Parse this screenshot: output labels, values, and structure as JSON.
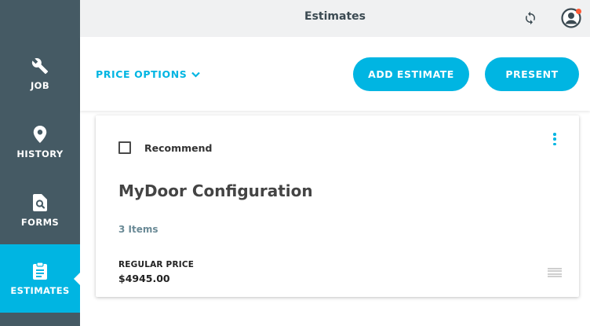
{
  "header": {
    "title": "Estimates"
  },
  "sidebar": {
    "items": [
      {
        "label": "JOB",
        "icon": "wrench-icon"
      },
      {
        "label": "HISTORY",
        "icon": "map-pin-icon"
      },
      {
        "label": "FORMS",
        "icon": "document-search-icon"
      },
      {
        "label": "ESTIMATES",
        "icon": "clipboard-icon",
        "active": true
      }
    ]
  },
  "toolbar": {
    "price_options_label": "PRICE OPTIONS",
    "add_estimate_label": "ADD ESTIMATE",
    "present_label": "PRESENT"
  },
  "estimate_card": {
    "recommend_label": "Recommend",
    "recommend_checked": false,
    "title": "MyDoor Configuration",
    "item_count": "3 Items",
    "regular_price_label": "REGULAR PRICE",
    "regular_price_value": "$4945.00"
  },
  "colors": {
    "sidebar_bg": "#455a64",
    "accent": "#00b5e2",
    "header_bg": "#f0f1f2",
    "notification_dot": "#ff5a36"
  }
}
